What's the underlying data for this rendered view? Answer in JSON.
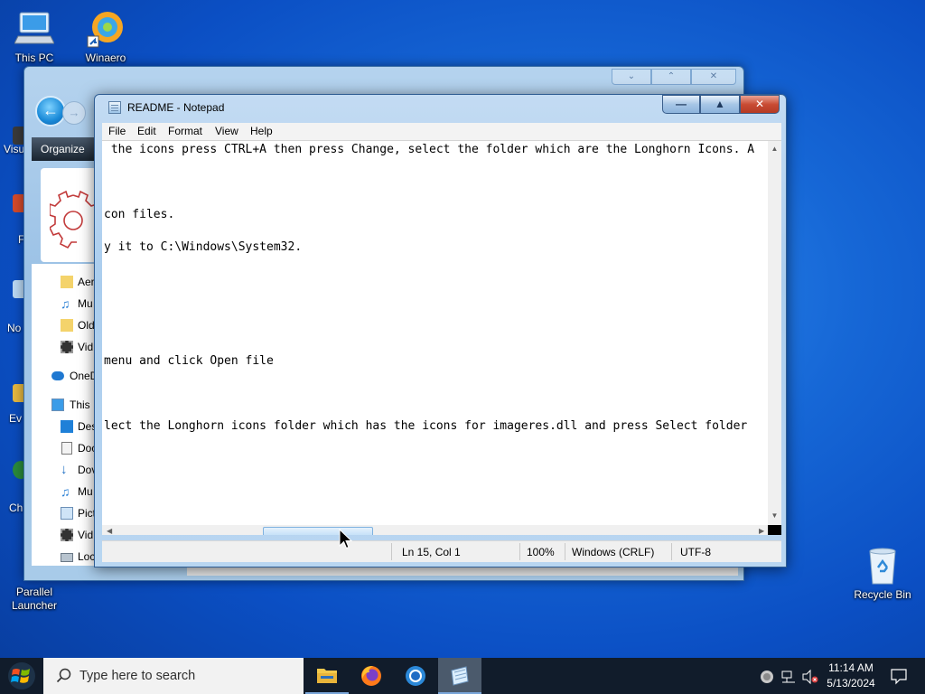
{
  "desktop": {
    "icons": {
      "this_pc": "This PC",
      "winaero": "Winaero",
      "recycle_bin": "Recycle Bin",
      "parallel_launcher": "Parallel\nLauncher"
    },
    "partial_labels": [
      "Visu",
      "F",
      "No",
      "Ev",
      "Ch"
    ]
  },
  "explorer": {
    "toolbar_organize": "Organize",
    "nav_items": [
      "Aer",
      "Mu",
      "Old",
      "Vid",
      "OneD",
      "This I",
      "Des",
      "Doc",
      "Dov",
      "Mu",
      "Pict",
      "Vid",
      "Loc"
    ]
  },
  "notepad": {
    "title": "README - Notepad",
    "menu": [
      "File",
      "Edit",
      "Format",
      "View",
      "Help"
    ],
    "lines": [
      " the icons press CTRL+A then press Change, select the folder which are the Longhorn Icons. A",
      "",
      "",
      "",
      "con files.",
      "",
      "y it to C:\\Windows\\System32.",
      "",
      "",
      "",
      "",
      "",
      "",
      "menu and click Open file",
      "",
      "",
      "",
      "lect the Longhorn icons folder which has the icons for imageres.dll and press Select folder"
    ],
    "status": {
      "position": "Ln 15, Col 1",
      "zoom": "100%",
      "line_ending": "Windows (CRLF)",
      "encoding": "UTF-8"
    }
  },
  "taskbar": {
    "search_placeholder": "Type here to search",
    "apps": [
      "file-explorer",
      "firefox",
      "chrome",
      "notepad"
    ],
    "clock_time": "11:14 AM",
    "clock_date": "5/13/2024"
  }
}
